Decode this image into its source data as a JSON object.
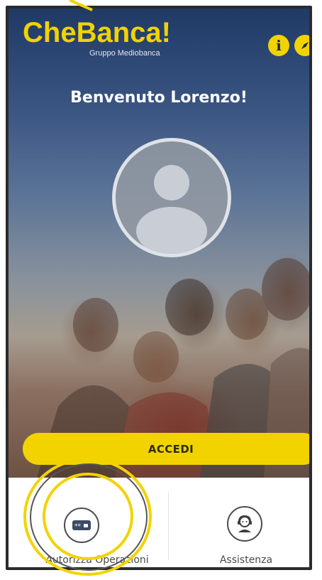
{
  "app": {
    "logo_title": "CheBanca!",
    "logo_subtitle": "Gruppo Mediobanca",
    "welcome": "Benvenuto Lorenzo!"
  },
  "header": {
    "info_icon": "info-icon",
    "compass_icon": "compass-icon",
    "info_glyph": "i"
  },
  "login": {
    "button_label": "ACCEDI"
  },
  "bottom_nav": {
    "items": [
      {
        "icon": "otp-token-icon",
        "label": "Autorizza Operazioni"
      },
      {
        "icon": "support-agent-icon",
        "label": "Assistenza"
      }
    ]
  },
  "colors": {
    "brand_yellow": "#f2d300",
    "header_blue": "#203a66",
    "nav_text": "#4a4a4a"
  }
}
